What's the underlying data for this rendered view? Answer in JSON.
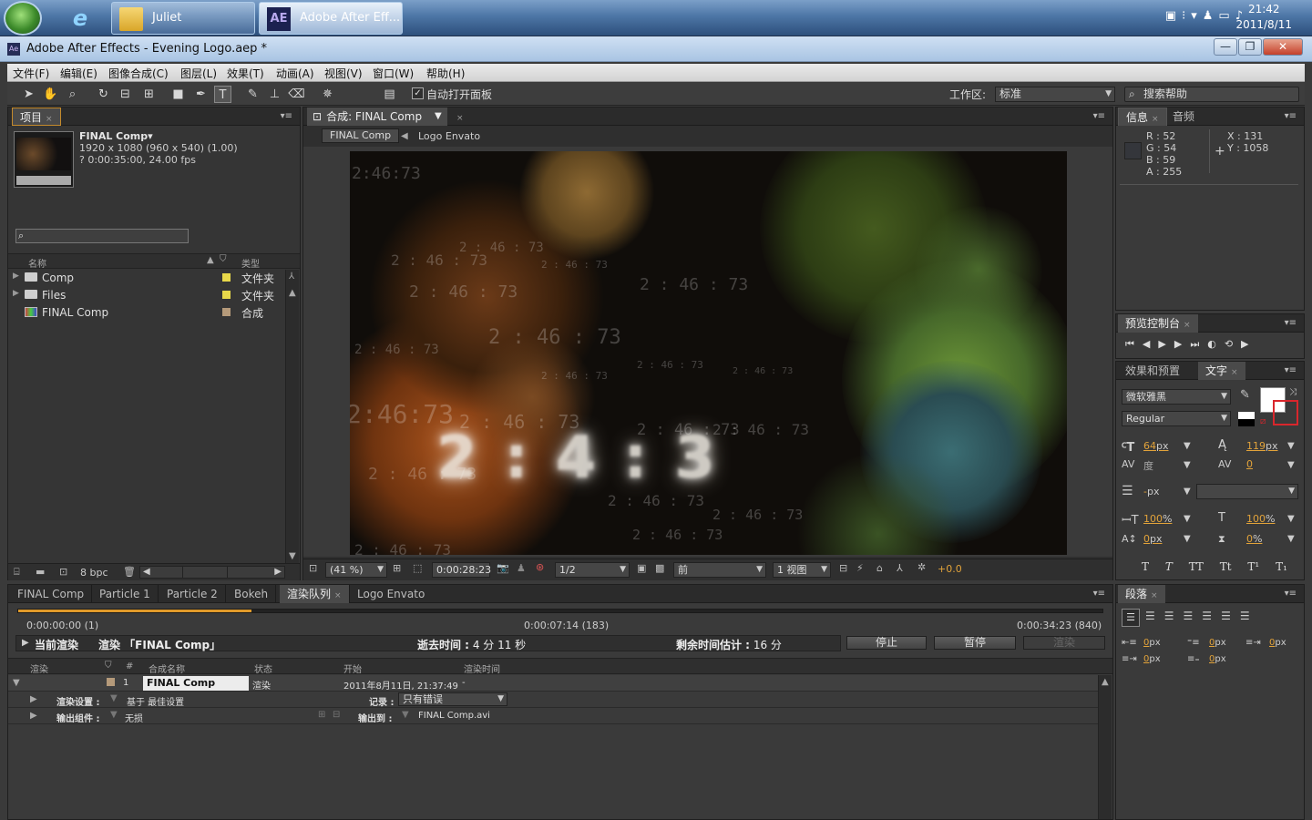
{
  "taskbar": {
    "buttons": [
      {
        "label": "Juliet",
        "icon": "folder-icon"
      },
      {
        "label": "Adobe After Eff...",
        "icon": "ae-app-icon"
      }
    ],
    "clock_time": "21:42",
    "clock_date": "2011/8/11"
  },
  "window": {
    "app_icon_text": "Ae",
    "title": "Adobe After Effects - Evening Logo.aep *"
  },
  "menu": [
    "文件(F)",
    "编辑(E)",
    "图像合成(C)",
    "图层(L)",
    "效果(T)",
    "动画(A)",
    "视图(V)",
    "窗口(W)",
    "帮助(H)"
  ],
  "toolbar": {
    "auto_open_label": "自动打开面板",
    "auto_open_checked": true,
    "workspace_label": "工作区:",
    "workspace_value": "标准",
    "search_help": "搜索帮助"
  },
  "project": {
    "tab": "项目",
    "comp_name": "FINAL Comp▾",
    "comp_size": "1920 x 1080  (960 x 540) (1.00)",
    "comp_duration": "? 0:00:35:00, 24.00 fps",
    "col_name": "名称",
    "col_type": "类型",
    "items": [
      {
        "name": "Comp",
        "type": "文件夹",
        "label_color": "#e8d84a",
        "icon": "folder-icon"
      },
      {
        "name": "Files",
        "type": "文件夹",
        "label_color": "#e8d84a",
        "icon": "folder-icon"
      },
      {
        "name": "FINAL Comp",
        "type": "合成",
        "label_color": "#b59a7a",
        "icon": "composition-icon"
      }
    ],
    "bpc": "8 bpc"
  },
  "composition": {
    "tab": "合成: FINAL Comp",
    "crumb_active": "FINAL Comp",
    "crumb_next": "Logo Envato",
    "zoom": "(41 %)",
    "timecode": "0:00:28:23",
    "resolution": "1/2",
    "camera": "前",
    "views": "1 视图",
    "exposure": "+0.0",
    "overlay_numbers": [
      "2:46:73",
      "2 : 46 : 73",
      "2 : 46 : 73",
      "2 : 46 : 73",
      "2 : 46 : 73",
      "2 : 46 : 73",
      "2 : 46 : 73",
      "2 : 46 : 73",
      "2 : 46 : 73",
      "2 : 46 : 73",
      "2 : 46 : 73",
      "2 : 46 : 73",
      "2 : 46 : 73",
      "2 : 46 : 73",
      "2 : 46 : 73",
      "2 : 46 : 73",
      "2:46:73",
      "2 : 46 : 73",
      "2 : 46 : 73",
      "2 : 46 : 73"
    ],
    "main_number": "2 : 4 : 3"
  },
  "info": {
    "tab_info": "信息",
    "tab_audio": "音频",
    "swatch_color": "#34363b",
    "r": "R : 52",
    "g": "G : 54",
    "b": "B : 59",
    "a": "A : 255",
    "x": "X : 131",
    "y": "Y : 1058"
  },
  "preview": {
    "tab": "预览控制台"
  },
  "character": {
    "tab_effects": "效果和预置",
    "tab_text": "文字",
    "font": "微软雅黑",
    "style": "Regular",
    "size": "64",
    "size_unit": "px",
    "leading": "119",
    "leading_unit": "px",
    "kerning": "度",
    "tracking": "0",
    "stroke": "-",
    "stroke_unit": "px",
    "vscale": "100",
    "hscale": "100",
    "baseline": "0",
    "baseline_unit": "px",
    "tsume": "0",
    "percent": "%",
    "fill_color": "#ffffff",
    "stroke_color": "#d9262c",
    "style_buttons": [
      "T",
      "T",
      "TT",
      "Tt",
      "T¹",
      "T₁"
    ]
  },
  "paragraph": {
    "tab": "段落",
    "fields": [
      {
        "value": "0",
        "unit": "px"
      },
      {
        "value": "0",
        "unit": "px"
      },
      {
        "value": "0",
        "unit": "px"
      },
      {
        "value": "0",
        "unit": "px"
      },
      {
        "value": "0",
        "unit": "px"
      }
    ]
  },
  "render_queue": {
    "tabs": [
      "FINAL Comp",
      "Particle 1",
      "Particle 2",
      "Bokeh",
      "渲染队列",
      "Logo Envato"
    ],
    "active_tab_index": 4,
    "time_start": "0:00:00:00 (1)",
    "time_mid": "0:00:07:14 (183)",
    "time_end": "0:00:34:23 (840)",
    "progress": 0.215,
    "current_render_label": "当前渲染",
    "rendering_label": "渲染 「FINAL Comp」",
    "elapsed_label": "逝去时间 :",
    "elapsed_value": "4 分 11 秒",
    "remaining_label": "剩余时间估计 :",
    "remaining_value": "16 分",
    "stop": "停止",
    "pause": "暂停",
    "render": "渲染",
    "cols": [
      "渲染",
      "#",
      "合成名称",
      "状态",
      "开始",
      "渲染时间"
    ],
    "item": {
      "index": "1",
      "comp": "FINAL Comp",
      "status": "渲染",
      "start": "2011年8月11日, 21:37:49",
      "render_time": "-"
    },
    "render_settings_label": "渲染设置 :",
    "render_settings_value": "基于 最佳设置",
    "log_label": "记录 :",
    "log_value": "只有错误",
    "output_module_label": "输出组件 :",
    "output_module_value": "无损",
    "output_to_label": "输出到 :",
    "output_to_value": "FINAL Comp.avi"
  }
}
